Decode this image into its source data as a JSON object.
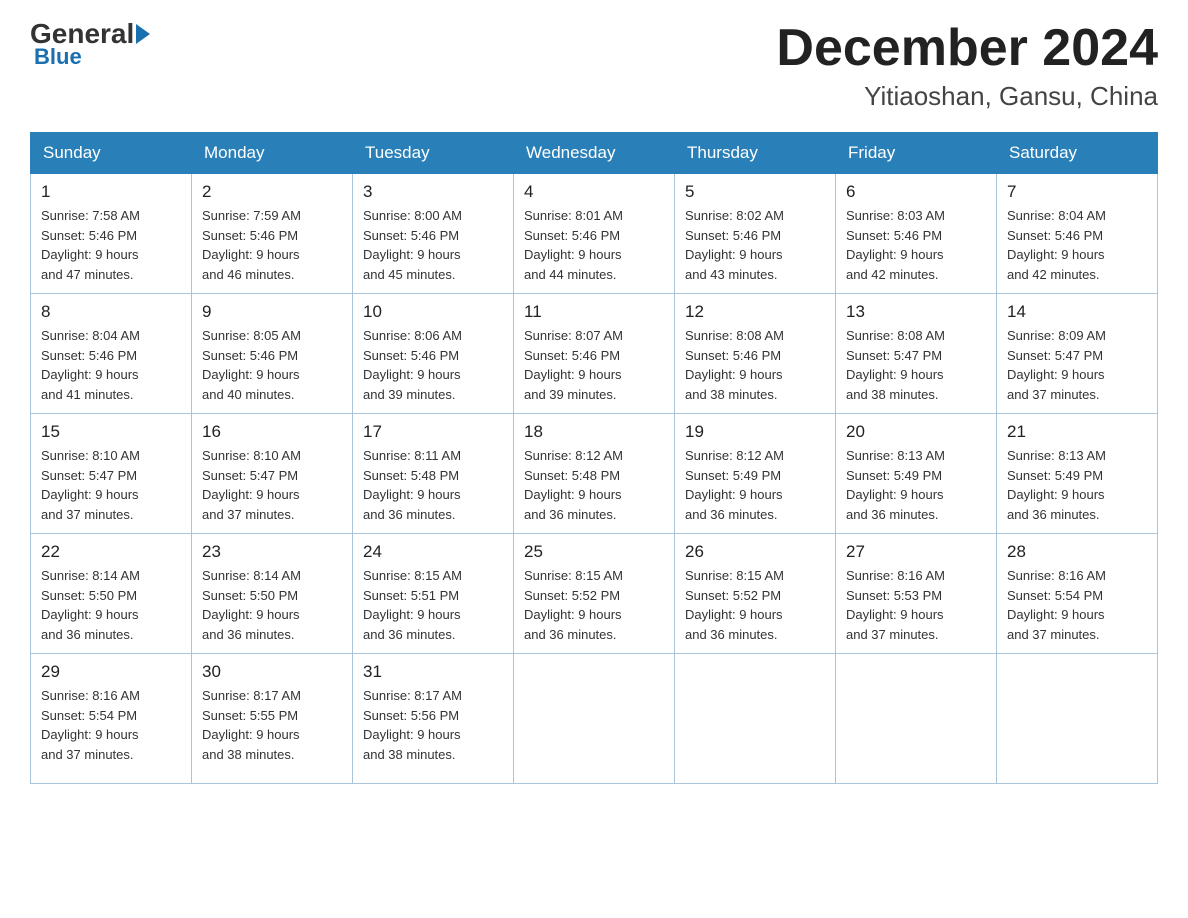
{
  "logo": {
    "general": "General",
    "blue": "Blue"
  },
  "header": {
    "month": "December 2024",
    "location": "Yitiaoshan, Gansu, China"
  },
  "weekdays": [
    "Sunday",
    "Monday",
    "Tuesday",
    "Wednesday",
    "Thursday",
    "Friday",
    "Saturday"
  ],
  "weeks": [
    [
      {
        "day": "1",
        "sunrise": "7:58 AM",
        "sunset": "5:46 PM",
        "daylight": "9 hours and 47 minutes."
      },
      {
        "day": "2",
        "sunrise": "7:59 AM",
        "sunset": "5:46 PM",
        "daylight": "9 hours and 46 minutes."
      },
      {
        "day": "3",
        "sunrise": "8:00 AM",
        "sunset": "5:46 PM",
        "daylight": "9 hours and 45 minutes."
      },
      {
        "day": "4",
        "sunrise": "8:01 AM",
        "sunset": "5:46 PM",
        "daylight": "9 hours and 44 minutes."
      },
      {
        "day": "5",
        "sunrise": "8:02 AM",
        "sunset": "5:46 PM",
        "daylight": "9 hours and 43 minutes."
      },
      {
        "day": "6",
        "sunrise": "8:03 AM",
        "sunset": "5:46 PM",
        "daylight": "9 hours and 42 minutes."
      },
      {
        "day": "7",
        "sunrise": "8:04 AM",
        "sunset": "5:46 PM",
        "daylight": "9 hours and 42 minutes."
      }
    ],
    [
      {
        "day": "8",
        "sunrise": "8:04 AM",
        "sunset": "5:46 PM",
        "daylight": "9 hours and 41 minutes."
      },
      {
        "day": "9",
        "sunrise": "8:05 AM",
        "sunset": "5:46 PM",
        "daylight": "9 hours and 40 minutes."
      },
      {
        "day": "10",
        "sunrise": "8:06 AM",
        "sunset": "5:46 PM",
        "daylight": "9 hours and 39 minutes."
      },
      {
        "day": "11",
        "sunrise": "8:07 AM",
        "sunset": "5:46 PM",
        "daylight": "9 hours and 39 minutes."
      },
      {
        "day": "12",
        "sunrise": "8:08 AM",
        "sunset": "5:46 PM",
        "daylight": "9 hours and 38 minutes."
      },
      {
        "day": "13",
        "sunrise": "8:08 AM",
        "sunset": "5:47 PM",
        "daylight": "9 hours and 38 minutes."
      },
      {
        "day": "14",
        "sunrise": "8:09 AM",
        "sunset": "5:47 PM",
        "daylight": "9 hours and 37 minutes."
      }
    ],
    [
      {
        "day": "15",
        "sunrise": "8:10 AM",
        "sunset": "5:47 PM",
        "daylight": "9 hours and 37 minutes."
      },
      {
        "day": "16",
        "sunrise": "8:10 AM",
        "sunset": "5:47 PM",
        "daylight": "9 hours and 37 minutes."
      },
      {
        "day": "17",
        "sunrise": "8:11 AM",
        "sunset": "5:48 PM",
        "daylight": "9 hours and 36 minutes."
      },
      {
        "day": "18",
        "sunrise": "8:12 AM",
        "sunset": "5:48 PM",
        "daylight": "9 hours and 36 minutes."
      },
      {
        "day": "19",
        "sunrise": "8:12 AM",
        "sunset": "5:49 PM",
        "daylight": "9 hours and 36 minutes."
      },
      {
        "day": "20",
        "sunrise": "8:13 AM",
        "sunset": "5:49 PM",
        "daylight": "9 hours and 36 minutes."
      },
      {
        "day": "21",
        "sunrise": "8:13 AM",
        "sunset": "5:49 PM",
        "daylight": "9 hours and 36 minutes."
      }
    ],
    [
      {
        "day": "22",
        "sunrise": "8:14 AM",
        "sunset": "5:50 PM",
        "daylight": "9 hours and 36 minutes."
      },
      {
        "day": "23",
        "sunrise": "8:14 AM",
        "sunset": "5:50 PM",
        "daylight": "9 hours and 36 minutes."
      },
      {
        "day": "24",
        "sunrise": "8:15 AM",
        "sunset": "5:51 PM",
        "daylight": "9 hours and 36 minutes."
      },
      {
        "day": "25",
        "sunrise": "8:15 AM",
        "sunset": "5:52 PM",
        "daylight": "9 hours and 36 minutes."
      },
      {
        "day": "26",
        "sunrise": "8:15 AM",
        "sunset": "5:52 PM",
        "daylight": "9 hours and 36 minutes."
      },
      {
        "day": "27",
        "sunrise": "8:16 AM",
        "sunset": "5:53 PM",
        "daylight": "9 hours and 37 minutes."
      },
      {
        "day": "28",
        "sunrise": "8:16 AM",
        "sunset": "5:54 PM",
        "daylight": "9 hours and 37 minutes."
      }
    ],
    [
      {
        "day": "29",
        "sunrise": "8:16 AM",
        "sunset": "5:54 PM",
        "daylight": "9 hours and 37 minutes."
      },
      {
        "day": "30",
        "sunrise": "8:17 AM",
        "sunset": "5:55 PM",
        "daylight": "9 hours and 38 minutes."
      },
      {
        "day": "31",
        "sunrise": "8:17 AM",
        "sunset": "5:56 PM",
        "daylight": "9 hours and 38 minutes."
      },
      null,
      null,
      null,
      null
    ]
  ]
}
